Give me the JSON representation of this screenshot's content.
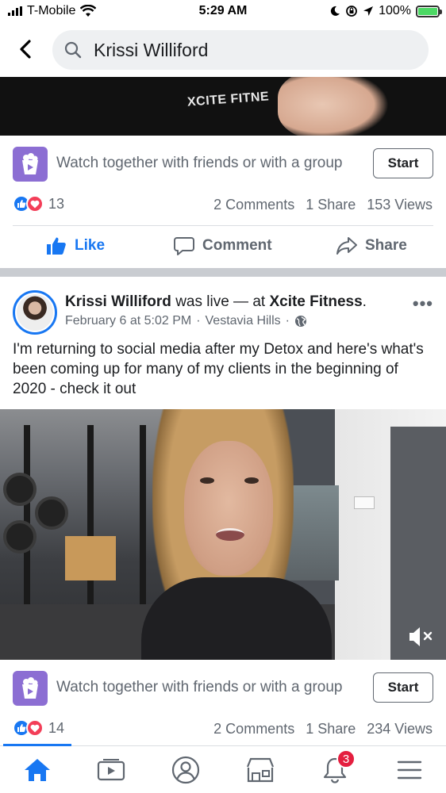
{
  "status_bar": {
    "carrier": "T-Mobile",
    "time": "5:29 AM",
    "battery": "100%",
    "icons": [
      "signal-icon",
      "wifi-icon",
      "moon-icon",
      "rotation-lock-icon",
      "location-icon",
      "battery-charging-icon"
    ]
  },
  "search": {
    "query": "Krissi Williford"
  },
  "top_video": {
    "shirt_text": "XCITE FITNE"
  },
  "watch_row_1": {
    "text": "Watch together with friends or with a group",
    "button": "Start"
  },
  "stats_1": {
    "reactions": "13",
    "comments": "2 Comments",
    "shares": "1 Share",
    "views": "153 Views"
  },
  "actions": {
    "like": "Like",
    "comment": "Comment",
    "share": "Share"
  },
  "post": {
    "author": "Krissi Williford",
    "was_live": "was live — at",
    "place": "Xcite Fitness",
    "place_suffix": ".",
    "date": "February 6 at 5:02 PM",
    "location": "Vestavia Hills",
    "separator": "·",
    "text": "I'm returning to social media after my Detox and here's what's been coming up for many of my clients in the beginning of 2020 - check it out",
    "more": "•••"
  },
  "watch_row_2": {
    "text": "Watch together with friends or with a group",
    "button": "Start"
  },
  "stats_2": {
    "reactions": "14",
    "comments": "2 Comments",
    "shares": "1 Share",
    "views": "234 Views"
  },
  "tabbar": {
    "notification_badge": "3",
    "tabs": [
      "home-icon",
      "watch-icon",
      "profile-icon",
      "marketplace-icon",
      "notifications-icon",
      "menu-icon"
    ],
    "accent": "#1877f2"
  }
}
